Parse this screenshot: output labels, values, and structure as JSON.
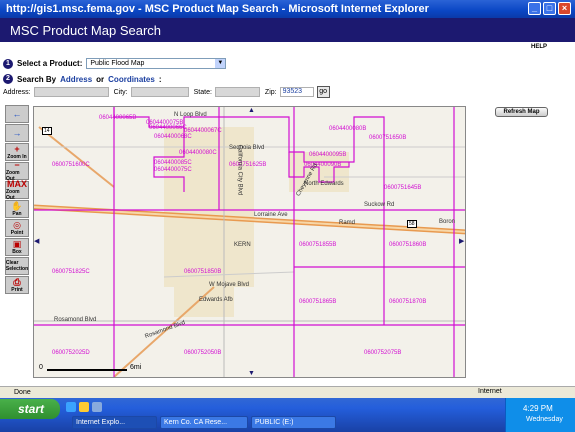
{
  "window": {
    "title": "http://gis1.msc.fema.gov - MSC Product Map Search - Microsoft Internet Explorer",
    "min": "_",
    "max": "□",
    "close": "×"
  },
  "banner": {
    "title": "MSC Product Map Search",
    "help": "HELP"
  },
  "search": {
    "step1_num": "1",
    "product_label": "Select a Product:",
    "product_value": "Public Flood Map",
    "step2_num": "2",
    "searchby_label": "Search By",
    "address_link": "Address",
    "or": "or",
    "coords_link": "Coordinates",
    "colon": ":",
    "address_label": "Address:",
    "city_label": "City:",
    "state_label": "State:",
    "zip_label": "Zip:",
    "zip_value": "93523",
    "go": "go"
  },
  "toolbar": {
    "tools": [
      {
        "name": "pan-left",
        "glyph": "←",
        "label": ""
      },
      {
        "name": "pan-right",
        "glyph": "→",
        "label": ""
      },
      {
        "name": "zoom-in",
        "glyph": "+",
        "label": "Zoom In"
      },
      {
        "name": "zoom-out",
        "glyph": "−",
        "label": "Zoom Out"
      },
      {
        "name": "max-zoom-out",
        "glyph": "MAX",
        "label": "Zoom Out"
      },
      {
        "name": "pan",
        "glyph": "✋",
        "label": "Pan"
      },
      {
        "name": "point",
        "glyph": "◎",
        "label": "Point"
      },
      {
        "name": "box",
        "glyph": "▣",
        "label": "Box"
      },
      {
        "name": "clear-selection",
        "glyph": "",
        "label": "Clear Selection"
      },
      {
        "name": "print",
        "glyph": "⎙",
        "label": "Print"
      }
    ]
  },
  "map": {
    "refresh": "Refresh Map",
    "panels": [
      "0604400065B",
      "0604400075B",
      "0604400080B",
      "0604400066C",
      "0604400067C",
      "0604400068C",
      "0600751650B",
      "0600751600C",
      "0600751625B",
      "0604400085C",
      "0604400090B",
      "0604400075C",
      "0604400080C",
      "0604400095B",
      "0600751645B",
      "0600751855B",
      "0600751860B",
      "0600751825C",
      "0600751850B",
      "0600751865B",
      "0600751870B",
      "0600752025D",
      "0600752050B",
      "0600752075B"
    ],
    "roads": [
      "N Loop Blvd",
      "Sequoia Blvd",
      "California City Blvd",
      "Cheyenne Rd",
      "North Edwards",
      "Suckow Rd",
      "Lorraine Ave",
      "Ramd",
      "Boron",
      "KERN",
      "W Mojave Blvd",
      "Edwards Afb",
      "Rosamond Blvd",
      "Rosamond Blvd"
    ],
    "shields": [
      "14",
      "58"
    ],
    "scale_start": "0",
    "scale_end": "6mi"
  },
  "status": {
    "done": "Done",
    "zone": "Internet"
  },
  "taskbar": {
    "start": "start",
    "tasks": [
      "Internet Explo...",
      "Kern Co. CA Rese...",
      "PUBLIC (E:)"
    ],
    "clock": "4:29 PM",
    "day": "Wednesday"
  }
}
